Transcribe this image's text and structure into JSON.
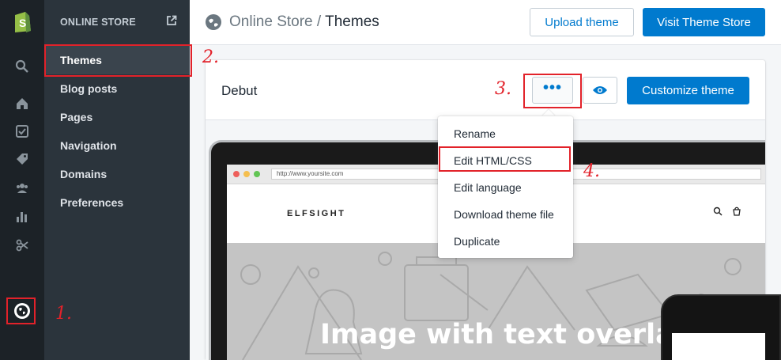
{
  "rail": {
    "icons": [
      "shopify-logo-icon",
      "search-icon",
      "home-icon",
      "orders-icon",
      "products-icon",
      "customers-icon",
      "analytics-icon",
      "discounts-icon",
      "online-store-icon"
    ]
  },
  "nav": {
    "header": "ONLINE STORE",
    "items": [
      {
        "label": "Themes"
      },
      {
        "label": "Blog posts"
      },
      {
        "label": "Pages"
      },
      {
        "label": "Navigation"
      },
      {
        "label": "Domains"
      },
      {
        "label": "Preferences"
      }
    ]
  },
  "header": {
    "breadcrumb_parent": "Online Store",
    "breadcrumb_sep": " / ",
    "breadcrumb_current": "Themes",
    "upload_label": "Upload theme",
    "visit_label": "Visit Theme Store"
  },
  "theme_card": {
    "name": "Debut",
    "more_label": "•••",
    "customize_label": "Customize theme"
  },
  "actions_menu": {
    "items": [
      "Rename",
      "Edit HTML/CSS",
      "Edit language",
      "Download theme file",
      "Duplicate"
    ]
  },
  "preview": {
    "url": "http://www.yoursite.com",
    "site_logo": "ELFSIGHT",
    "hero_text": "Image with text overlay"
  },
  "annotations": [
    "1.",
    "2.",
    "3.",
    "4."
  ],
  "colors": {
    "accent": "#007ace",
    "annotation": "#e2222a",
    "rail_bg": "#1c2227",
    "nav_bg": "#2b343c"
  }
}
